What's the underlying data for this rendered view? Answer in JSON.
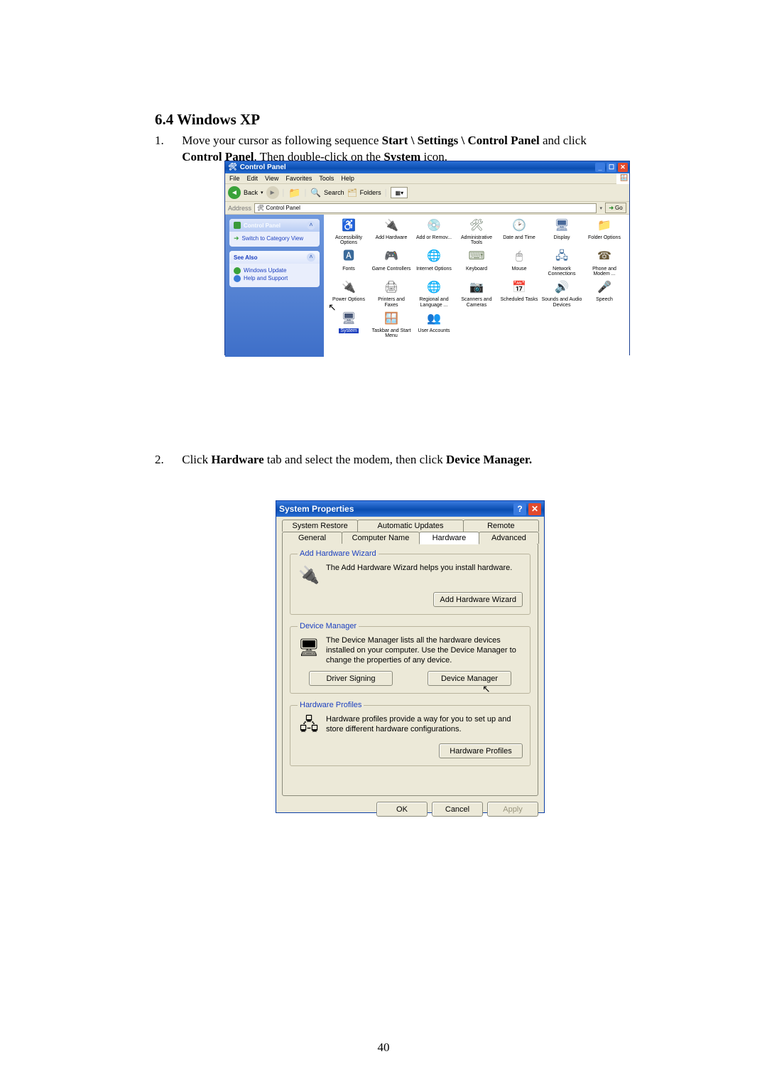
{
  "heading": "6.4 Windows XP",
  "step1_num": "1.",
  "step1_a": "Move your cursor as following sequence ",
  "step1_b": "Start \\ Settings \\ Control Panel",
  "step1_c": " and click ",
  "step1_d": "Control Panel",
  "step1_e": ". Then double-click on the ",
  "step1_f": "System",
  "step1_g": " icon.",
  "step2_num": "2.",
  "step2_a": "Click ",
  "step2_b": "Hardware",
  "step2_c": " tab and select the modem, then click ",
  "step2_d": "Device Manager.",
  "pagenum": "40",
  "cp": {
    "title": "Control Panel",
    "menu": [
      "File",
      "Edit",
      "View",
      "Favorites",
      "Tools",
      "Help"
    ],
    "back": "Back",
    "search": "Search",
    "folders": "Folders",
    "addr_label": "Address",
    "addr_value": "Control Panel",
    "go": "Go",
    "left1_title": "Control Panel",
    "left1_link": "Switch to Category View",
    "left2_title": "See Also",
    "left2_link1": "Windows Update",
    "left2_link2": "Help and Support",
    "items": [
      "Accessibility Options",
      "Add Hardware",
      "Add or Remov...",
      "Administrative Tools",
      "Date and Time",
      "Display",
      "Folder Options",
      "Fonts",
      "Game Controllers",
      "Internet Options",
      "Keyboard",
      "Mouse",
      "Network Connections",
      "Phone and Modem ...",
      "Power Options",
      "Printers and Faxes",
      "Regional and Language ...",
      "Scanners and Cameras",
      "Scheduled Tasks",
      "Sounds and Audio Devices",
      "Speech",
      "System",
      "Taskbar and Start Menu",
      "User Accounts"
    ]
  },
  "sp": {
    "title": "System Properties",
    "tabs_row1": [
      "System Restore",
      "Automatic Updates",
      "Remote"
    ],
    "tabs_row2": [
      "General",
      "Computer Name",
      "Hardware",
      "Advanced"
    ],
    "hw": {
      "legend": "Add Hardware Wizard",
      "text": "The Add Hardware Wizard helps you install hardware.",
      "btn": "Add Hardware Wizard"
    },
    "dm": {
      "legend": "Device Manager",
      "text": "The Device Manager lists all the hardware devices installed on your computer. Use the Device Manager to change the properties of any device.",
      "btn1": "Driver Signing",
      "btn2": "Device Manager"
    },
    "hp": {
      "legend": "Hardware Profiles",
      "text": "Hardware profiles provide a way for you to set up and store different hardware configurations.",
      "btn": "Hardware Profiles"
    },
    "ok": "OK",
    "cancel": "Cancel",
    "apply": "Apply"
  }
}
